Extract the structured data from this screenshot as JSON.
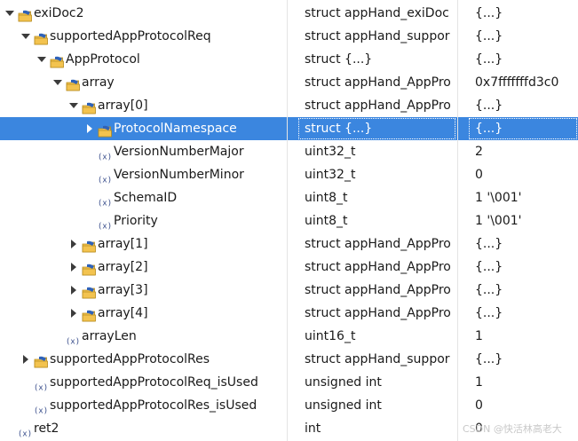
{
  "rows": [
    {
      "depth": 0,
      "expander": "expanded",
      "icon": "struct-icon",
      "name": "exiDoc2",
      "type": "struct appHand_exiDoc",
      "value": "{...}",
      "selected": false
    },
    {
      "depth": 1,
      "expander": "expanded",
      "icon": "struct-icon",
      "name": "supportedAppProtocolReq",
      "type": "struct appHand_suppor",
      "value": "{...}",
      "selected": false
    },
    {
      "depth": 2,
      "expander": "expanded",
      "icon": "struct-icon",
      "name": "AppProtocol",
      "type": "struct {...}",
      "value": "{...}",
      "selected": false
    },
    {
      "depth": 3,
      "expander": "expanded",
      "icon": "struct-icon",
      "name": "array",
      "type": "struct appHand_AppPro",
      "value": "0x7fffffffd3c0",
      "selected": false
    },
    {
      "depth": 4,
      "expander": "expanded",
      "icon": "struct-icon",
      "name": "array[0]",
      "type": "struct appHand_AppPro",
      "value": "{...}",
      "selected": false
    },
    {
      "depth": 5,
      "expander": "collapsed",
      "icon": "struct-icon",
      "name": "ProtocolNamespace",
      "type": "struct {...}",
      "value": "{...}",
      "selected": true
    },
    {
      "depth": 5,
      "expander": "none",
      "icon": "variable-icon",
      "name": "VersionNumberMajor",
      "type": "uint32_t",
      "value": "2",
      "selected": false
    },
    {
      "depth": 5,
      "expander": "none",
      "icon": "variable-icon",
      "name": "VersionNumberMinor",
      "type": "uint32_t",
      "value": "0",
      "selected": false
    },
    {
      "depth": 5,
      "expander": "none",
      "icon": "variable-icon",
      "name": "SchemaID",
      "type": "uint8_t",
      "value": "1 '\\001'",
      "selected": false
    },
    {
      "depth": 5,
      "expander": "none",
      "icon": "variable-icon",
      "name": "Priority",
      "type": "uint8_t",
      "value": "1 '\\001'",
      "selected": false
    },
    {
      "depth": 4,
      "expander": "collapsed",
      "icon": "struct-icon",
      "name": "array[1]",
      "type": "struct appHand_AppPro",
      "value": "{...}",
      "selected": false
    },
    {
      "depth": 4,
      "expander": "collapsed",
      "icon": "struct-icon",
      "name": "array[2]",
      "type": "struct appHand_AppPro",
      "value": "{...}",
      "selected": false
    },
    {
      "depth": 4,
      "expander": "collapsed",
      "icon": "struct-icon",
      "name": "array[3]",
      "type": "struct appHand_AppPro",
      "value": "{...}",
      "selected": false
    },
    {
      "depth": 4,
      "expander": "collapsed",
      "icon": "struct-icon",
      "name": "array[4]",
      "type": "struct appHand_AppPro",
      "value": "{...}",
      "selected": false
    },
    {
      "depth": 3,
      "expander": "none",
      "icon": "variable-icon",
      "name": "arrayLen",
      "type": "uint16_t",
      "value": "1",
      "selected": false
    },
    {
      "depth": 1,
      "expander": "collapsed",
      "icon": "struct-icon",
      "name": "supportedAppProtocolRes",
      "type": "struct appHand_suppor",
      "value": "{...}",
      "selected": false
    },
    {
      "depth": 1,
      "expander": "none",
      "icon": "variable-icon",
      "name": "supportedAppProtocolReq_isUsed",
      "type": "unsigned int",
      "value": "1",
      "selected": false
    },
    {
      "depth": 1,
      "expander": "none",
      "icon": "variable-icon",
      "name": "supportedAppProtocolRes_isUsed",
      "type": "unsigned int",
      "value": "0",
      "selected": false
    },
    {
      "depth": 0,
      "expander": "none",
      "icon": "variable-icon",
      "name": "ret2",
      "type": "int",
      "value": "0",
      "selected": false
    }
  ],
  "watermark": "CSDN @快活林高老大",
  "colors": {
    "selection": "#3b86df",
    "struct_icon_fill": "#f3c34f",
    "struct_icon_accent": "#2f62b8",
    "variable_icon": "#3a4f8c"
  }
}
